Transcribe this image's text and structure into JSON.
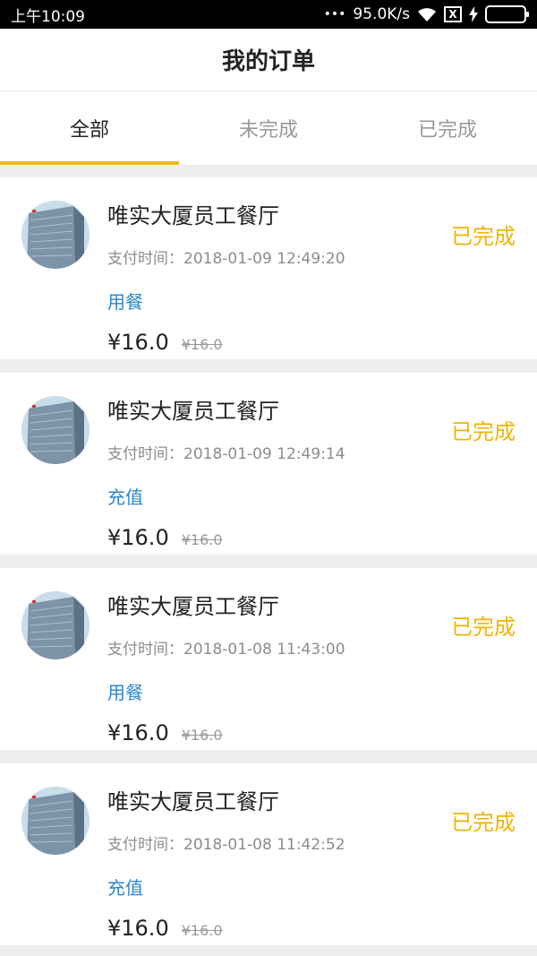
{
  "statusbar": {
    "time": "上午10:09",
    "dots": "•••",
    "speed": "95.0K/s",
    "sim": "X"
  },
  "header": {
    "title": "我的订单"
  },
  "tabs": [
    {
      "label": "全部",
      "active": true
    },
    {
      "label": "未完成",
      "active": false
    },
    {
      "label": "已完成",
      "active": false
    }
  ],
  "orders": [
    {
      "shop": "唯实大厦员工餐厅",
      "time_label": "支付时间：",
      "time": "2018-01-09 12:49:20",
      "type": "用餐",
      "price": "¥16.0",
      "orig": "¥16.0",
      "status": "已完成"
    },
    {
      "shop": "唯实大厦员工餐厅",
      "time_label": "支付时间：",
      "time": "2018-01-09 12:49:14",
      "type": "充值",
      "price": "¥16.0",
      "orig": "¥16.0",
      "status": "已完成"
    },
    {
      "shop": "唯实大厦员工餐厅",
      "time_label": "支付时间：",
      "time": "2018-01-08 11:43:00",
      "type": "用餐",
      "price": "¥16.0",
      "orig": "¥16.0",
      "status": "已完成"
    },
    {
      "shop": "唯实大厦员工餐厅",
      "time_label": "支付时间：",
      "time": "2018-01-08 11:42:52",
      "type": "充值",
      "price": "¥16.0",
      "orig": "¥16.0",
      "status": "已完成"
    }
  ],
  "colors": {
    "accent": "#f2b90f",
    "status": "#f0b400",
    "type_link": "#2e86c8"
  }
}
